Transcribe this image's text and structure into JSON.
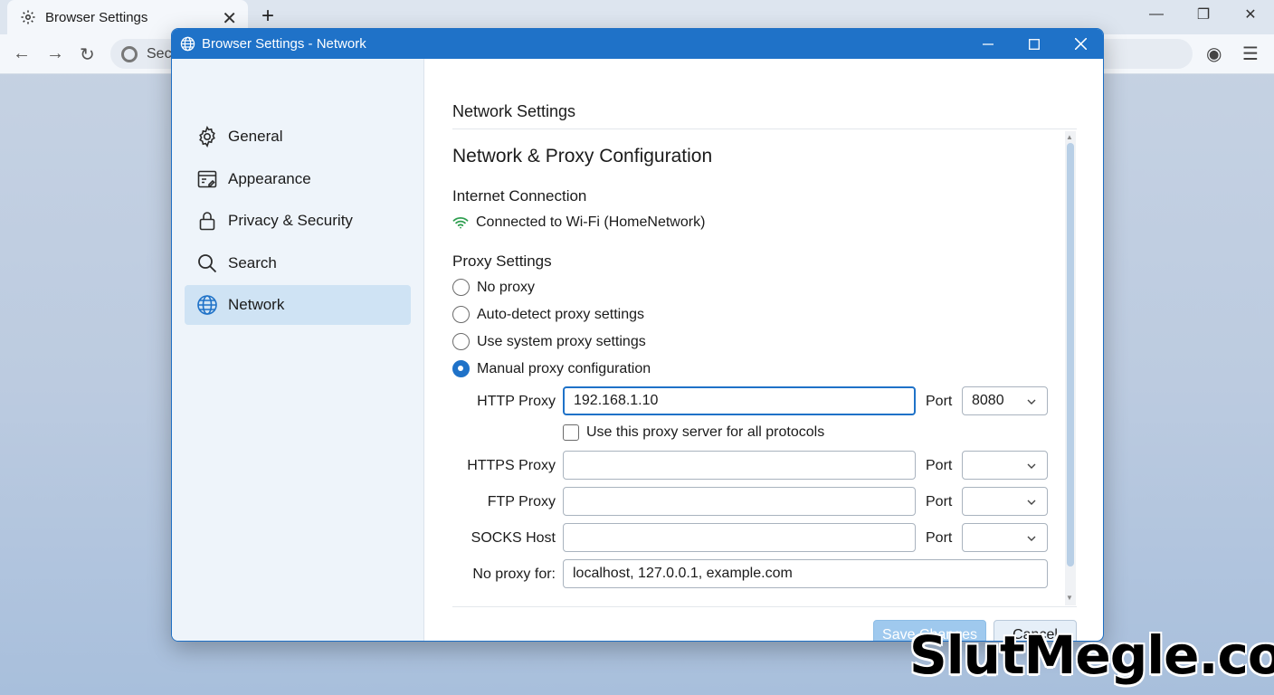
{
  "browser": {
    "tab_title": "Browser Settings",
    "omnibox_text": "Sec"
  },
  "dialog": {
    "title": "Browser Settings - Network"
  },
  "sidebar": {
    "items": [
      {
        "label": "General",
        "icon": "gear-icon"
      },
      {
        "label": "Appearance",
        "icon": "appearance-icon"
      },
      {
        "label": "Privacy & Security",
        "icon": "lock-icon"
      },
      {
        "label": "Search",
        "icon": "search-icon"
      },
      {
        "label": "Network",
        "icon": "globe-icon",
        "active": true
      }
    ]
  },
  "content": {
    "section_title": "Network Settings",
    "page_title": "Network & Proxy Configuration",
    "internet_heading": "Internet Connection",
    "connection_status": "Connected to Wi-Fi (HomeNetwork)",
    "proxy_heading": "Proxy Settings",
    "proxy_options": [
      {
        "label": "No proxy",
        "checked": false
      },
      {
        "label": "Auto-detect proxy settings",
        "checked": false
      },
      {
        "label": "Use system proxy settings",
        "checked": false
      },
      {
        "label": "Manual proxy configuration",
        "checked": true
      }
    ],
    "http_label": "HTTP Proxy",
    "http_value": "192.168.1.10",
    "http_port": "8080",
    "use_all_label": "Use this proxy server for all protocols",
    "https_label": "HTTPS Proxy",
    "https_value": "",
    "https_port": "",
    "ftp_label": "FTP Proxy",
    "ftp_value": "",
    "ftp_port": "",
    "socks_label": "SOCKS Host",
    "socks_value": "",
    "socks_port": "",
    "port_label": "Port",
    "noproxy_label": "No proxy for:",
    "noproxy_value": "localhost, 127.0.0.1, example.com",
    "save_label": "Save Changes",
    "cancel_label": "Cancel"
  },
  "colors": {
    "accent": "#1f72c8",
    "wifi": "#2e9e4f",
    "active_nav": "#cfe3f4"
  },
  "watermark": "SlutMegle.com"
}
